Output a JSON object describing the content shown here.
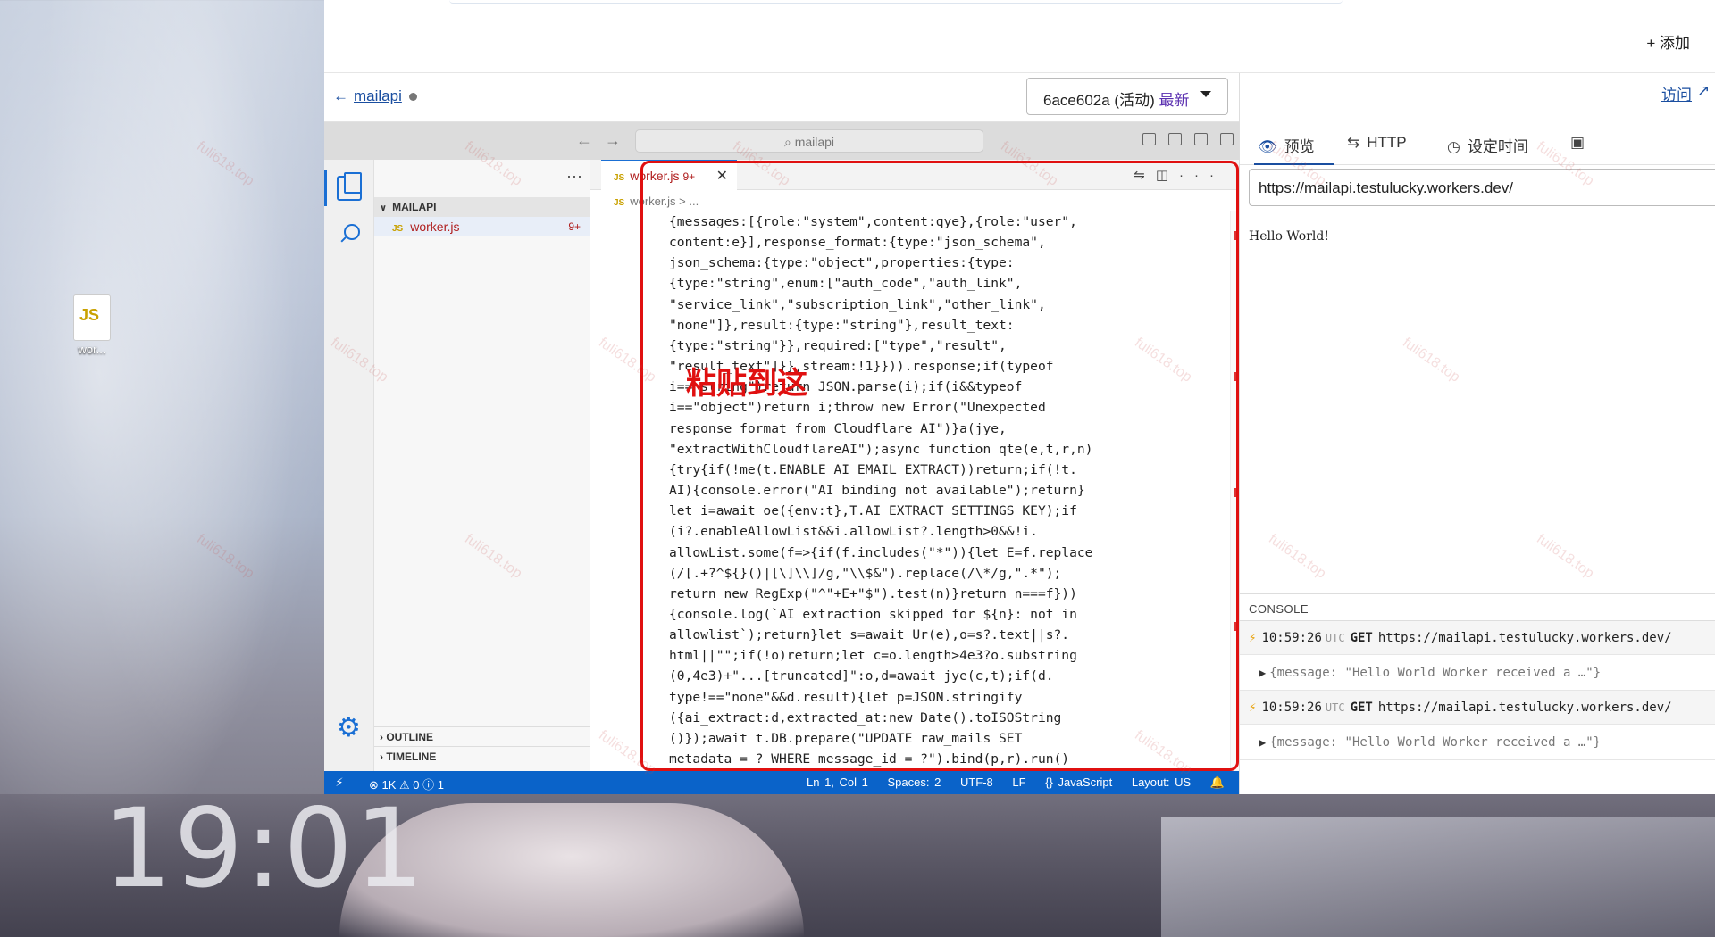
{
  "desktop": {
    "clock": "19:01",
    "icon_label": "wor...",
    "icon_badge": "JS"
  },
  "top": {
    "add_label": "+ 添加"
  },
  "project": {
    "back_name": "mailapi",
    "version_id": "6ace602a",
    "version_status": "(活动)",
    "version_latest": "最新"
  },
  "vscode": {
    "search_placeholder": "mailapi",
    "folder_name": "MAILAPI",
    "file_name": "worker.js",
    "file_badge": "9+",
    "tab_label": "worker.js",
    "tab_count": "9+",
    "breadcrumb": "worker.js > ...",
    "outline_label": "OUTLINE",
    "timeline_label": "TIMELINE",
    "code_lines": [
      "{messages:[{role:\"system\",content:qye},{role:\"user\",",
      "content:e}],response_format:{type:\"json_schema\",",
      "json_schema:{type:\"object\",properties:{type:",
      "{type:\"string\",enum:[\"auth_code\",\"auth_link\",",
      "\"service_link\",\"subscription_link\",\"other_link\",",
      "\"none\"]},result:{type:\"string\"},result_text:",
      "{type:\"string\"}},required:[\"type\",\"result\",",
      "\"result_text\"]}},stream:!1}})).response;if(typeof",
      "i== string\")return JSON.parse(i);if(i&&typeof",
      "i==\"object\")return i;throw new Error(\"Unexpected",
      "response format from Cloudflare AI\")}a(jye,",
      "\"extractWithCloudflareAI\");async function qte(e,t,r,n)",
      "{try{if(!me(t.ENABLE_AI_EMAIL_EXTRACT))return;if(!t.",
      "AI){console.error(\"AI binding not available\");return}",
      "let i=await oe({env:t},T.AI_EXTRACT_SETTINGS_KEY);if",
      "(i?.enableAllowList&&i.allowList?.length>0&&!i.",
      "allowList.some(f=>{if(f.includes(\"*\")){let E=f.replace",
      "(/[.+?^${}()|[\\]\\\\]/g,\"\\\\$&\").replace(/\\*/g,\".*\");",
      "return new RegExp(\"^\"+E+\"$\").test(n)}return n===f}))",
      "{console.log(`AI extraction skipped for ${n}: not in",
      "allowlist`);return}let s=await Ur(e),o=s?.text||s?.",
      "html||\"\";if(!o)return;let c=o.length>4e3?o.substring",
      "(0,4e3)+\"...[truncated]\":o,d=await jye(c,t);if(d.",
      "type!==\"none\"&&d.result){let p=JSON.stringify",
      "({ai_extract:d,extracted_at:new Date().toISOString",
      "()});await t.DB.prepare(\"UPDATE raw_mails SET",
      "metadata = ? WHERE message_id = ?\").bind(p,r).run()"
    ],
    "status": {
      "problems": "⊗ 1K ⚠ 0 ⓘ 1",
      "position": "Ln 1, Col 1",
      "spaces": "Spaces: 2",
      "encoding": "UTF-8",
      "eol": "LF",
      "language": "{} JavaScript",
      "layout": "Layout: US"
    }
  },
  "annotation": {
    "paste_here": "粘贴到这",
    "highlight_color": "#e01010"
  },
  "preview": {
    "visit_label": "访问",
    "tabs": [
      {
        "label": "预览",
        "icon": "eye-icon"
      },
      {
        "label": "HTTP",
        "icon": "swap-icon"
      },
      {
        "label": "设定时间",
        "icon": "clock-icon"
      },
      {
        "label": "",
        "icon": "terminal-icon"
      }
    ],
    "url": "https://mailapi.testulucky.workers.dev/",
    "body_text": "Hello World!"
  },
  "console": {
    "title": "CONSOLE",
    "logs": [
      {
        "time": "10:59:26",
        "tz": "UTC",
        "method": "GET",
        "url": "https://mailapi.testulucky.workers.dev/",
        "message": "{message: \"Hello World Worker received a …\"}"
      },
      {
        "time": "10:59:26",
        "tz": "UTC",
        "method": "GET",
        "url": "https://mailapi.testulucky.workers.dev/",
        "message": "{message: \"Hello World Worker received a …\"}"
      }
    ]
  },
  "watermark": "fuli618.top",
  "colors": {
    "accent": "#1a4ea0",
    "vscode_blue": "#0a63c9",
    "error_red": "#b02020"
  }
}
